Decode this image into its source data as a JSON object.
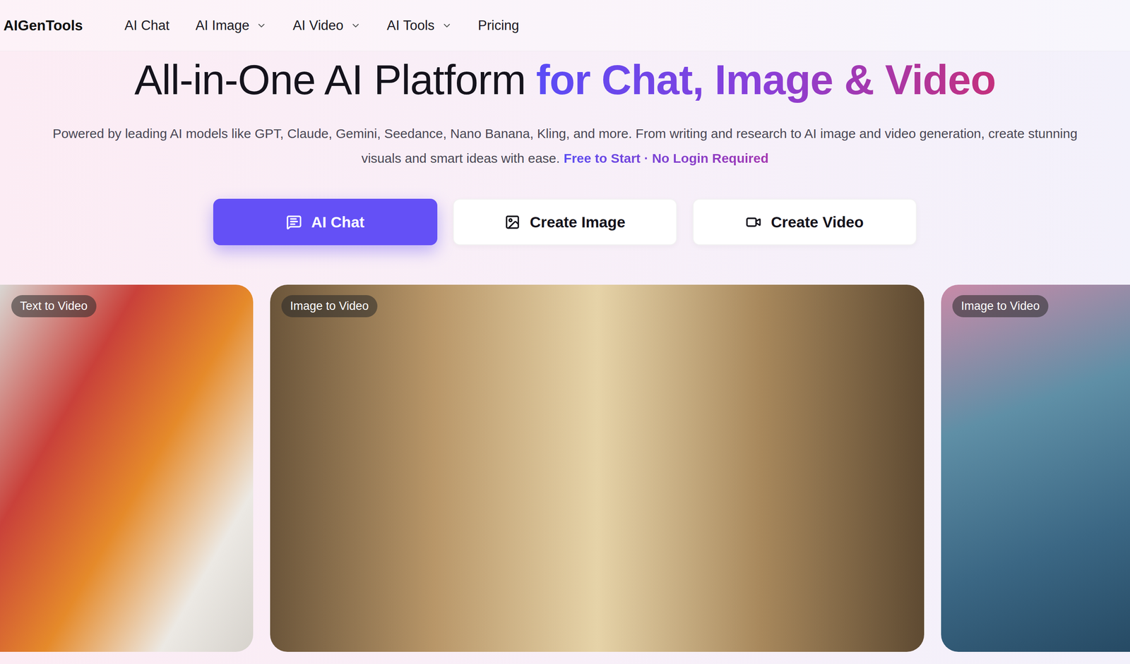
{
  "logo": "AIGenTools",
  "nav": [
    {
      "label": "AI Chat",
      "dropdown": false
    },
    {
      "label": "AI Image",
      "dropdown": true
    },
    {
      "label": "AI Video",
      "dropdown": true
    },
    {
      "label": "AI Tools",
      "dropdown": true
    },
    {
      "label": "Pricing",
      "dropdown": false
    }
  ],
  "hero": {
    "title": "All-in-One AI Platform",
    "title_highlight": "for Chat, Image & Video",
    "subtitle": "Powered by leading AI models like GPT, Claude, Gemini, Seedance, Nano Banana, Kling, and more. From writing and research to AI image and video generation, create stunning visuals and smart ideas with ease.",
    "subtitle_highlight": "Free to Start · No Login Required"
  },
  "actions": [
    {
      "label": "AI Chat",
      "kind": "chat",
      "selected": true
    },
    {
      "label": "Create Image",
      "kind": "image",
      "selected": false
    },
    {
      "label": "Create Video",
      "kind": "video",
      "selected": false
    }
  ],
  "showcase": [
    {
      "label": "Text to Video"
    },
    {
      "label": "Image to Video"
    },
    {
      "label": "Image to Video"
    }
  ]
}
